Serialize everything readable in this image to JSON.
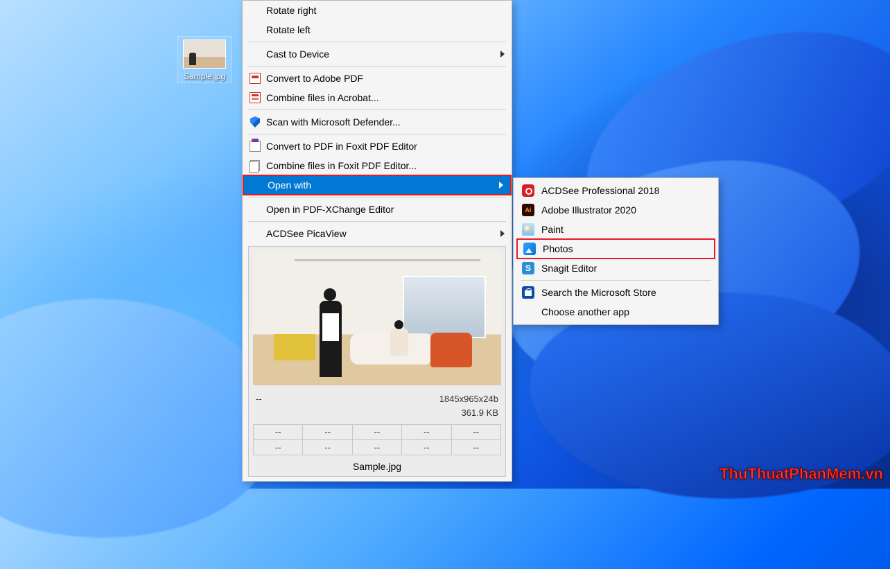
{
  "desktop_icon": {
    "label": "Sample.jpg"
  },
  "context_menu": {
    "rotate_right": "Rotate right",
    "rotate_left": "Rotate left",
    "cast_to_device": "Cast to Device",
    "convert_adobe": "Convert to Adobe PDF",
    "combine_acrobat": "Combine files in Acrobat...",
    "scan_defender": "Scan with Microsoft Defender...",
    "convert_foxit": "Convert to PDF in Foxit PDF Editor",
    "combine_foxit": "Combine files in Foxit PDF Editor...",
    "open_with": "Open with",
    "open_pdfxchange": "Open in PDF-XChange Editor",
    "acdsee_picaview": "ACDSee PicaView"
  },
  "picaview": {
    "placeholder": "--",
    "dimensions": "1845x965x24b",
    "filesize": "361.9 KB",
    "grid": [
      [
        "--",
        "--",
        "--",
        "--",
        "--"
      ],
      [
        "--",
        "--",
        "--",
        "--",
        "--"
      ]
    ],
    "filename": "Sample.jpg"
  },
  "open_with_submenu": {
    "acdsee": "ACDSee Professional 2018",
    "illustrator": "Adobe Illustrator 2020",
    "paint": "Paint",
    "photos": "Photos",
    "snagit": "Snagit Editor",
    "store": "Search the Microsoft Store",
    "choose": "Choose another app"
  },
  "watermark": "ThuThuatPhanMem.vn"
}
